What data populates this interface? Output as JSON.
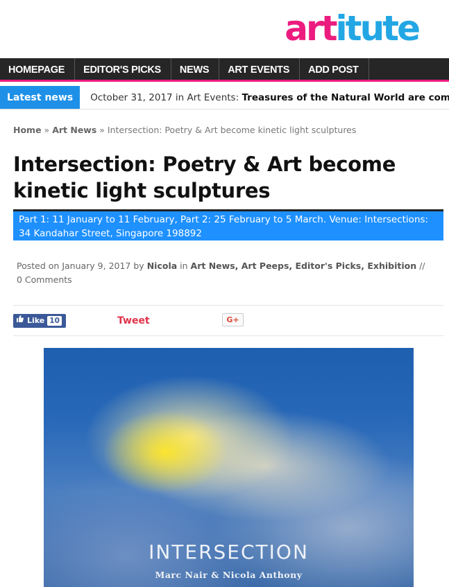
{
  "logo": {
    "part1": "art",
    "part2": "itute"
  },
  "nav": {
    "items": [
      "HOMEPAGE",
      "EDITOR'S PICKS",
      "NEWS",
      "ART EVENTS",
      "ADD POST"
    ]
  },
  "ticker": {
    "label": "Latest news",
    "date_text": "October 31, 2017 in Art Events:",
    "headline": "Treasures of the Natural World are coming alive at Ar"
  },
  "breadcrumb": {
    "home": "Home",
    "sep1": "»",
    "section": "Art News",
    "sep2": "»",
    "current": "Intersection: Poetry & Art become kinetic light sculptures"
  },
  "article": {
    "title": "Intersection: Poetry & Art become kinetic light sculptures",
    "subtitle": "Part 1: 11 January to 11 February, Part 2: 25 February to 5 March. Venue: Intersections: 34 Kandahar Street, Singapore 198892",
    "meta": {
      "posted_on": "Posted on",
      "date": "January 9, 2017",
      "by": "by",
      "author": "Nicola",
      "in": "in",
      "categories": "Art News, Art Peeps, Editor's Picks, Exhibition",
      "comments": "// 0 Comments"
    }
  },
  "social": {
    "like_label": "Like",
    "like_count": "10",
    "tweet_label": "Tweet",
    "gplus_label": "G+"
  },
  "hero": {
    "title": "INTERSECTION",
    "subtitle": "Marc Nair & Nicola Anthony"
  }
}
